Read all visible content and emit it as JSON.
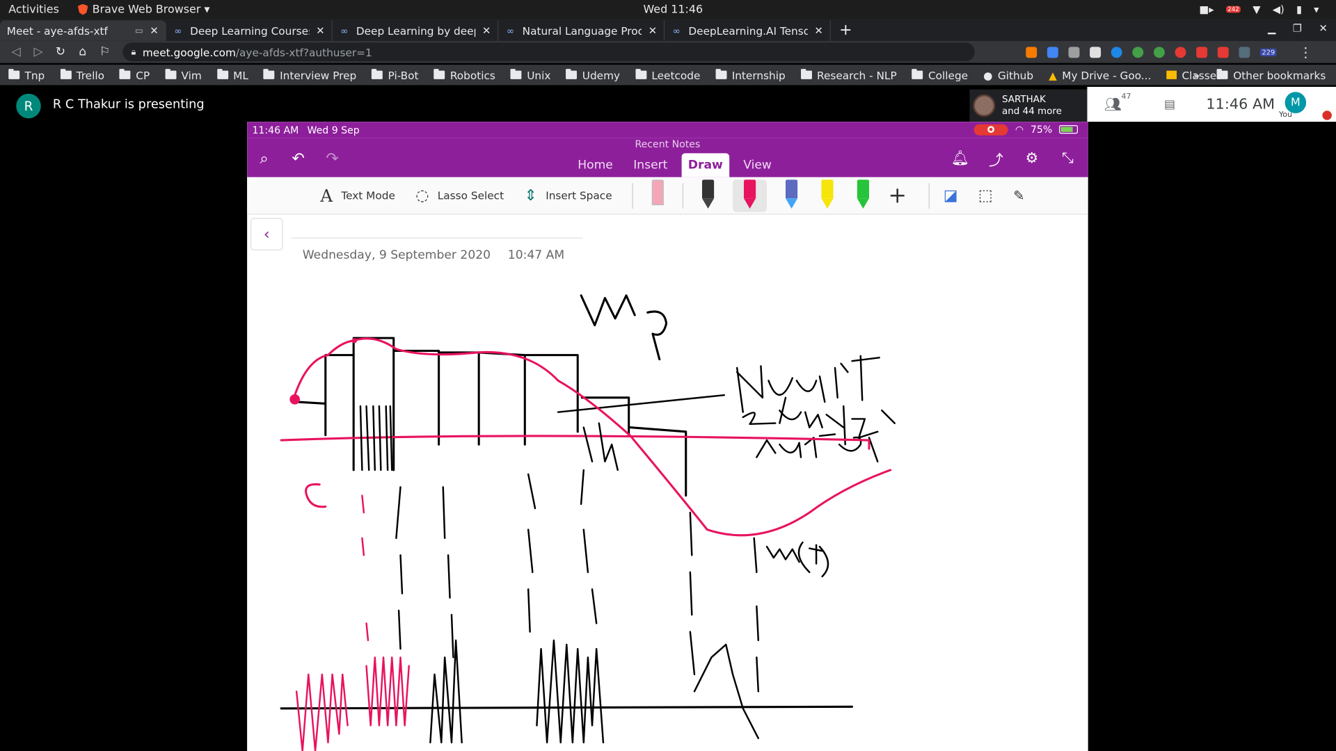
{
  "gnome": {
    "activities": "Activities",
    "app_name": "Brave Web Browser ▾",
    "clock": "Wed 11:46",
    "notification_count": "242"
  },
  "tabs": [
    {
      "title": "Meet - aye-afds-xtf",
      "active": true
    },
    {
      "title": "Deep Learning Courses | Co"
    },
    {
      "title": "Deep Learning by deeplear"
    },
    {
      "title": "Natural Language Processi"
    },
    {
      "title": "DeepLearning.AI TensorFlo"
    }
  ],
  "address": {
    "domain": "meet.google.com",
    "path": "/aye-afds-xtf?authuser=1"
  },
  "extensions": {
    "badge": "229"
  },
  "bookmarks": [
    "Tnp",
    "Trello",
    "CP",
    "Vim",
    "ML",
    "Interview Prep",
    "Pi-Bot",
    "Robotics",
    "Unix",
    "Udemy",
    "Leetcode",
    "Internship",
    "Research - NLP",
    "College"
  ],
  "bookmark_github": "Github",
  "bookmark_drive": "My Drive - Goo...",
  "bookmark_classes": "Classes",
  "bookmark_more": "»",
  "bookmark_other": "Other bookmarks",
  "meet": {
    "presenter_initial": "R",
    "presenting_text": "R C Thakur is presenting",
    "participant_name": "SARTHAK",
    "participant_more": "and 44 more",
    "people_count": "47",
    "time": "11:46  AM",
    "self_initial": "M",
    "self_label": "You"
  },
  "ipad": {
    "time": "11:46 AM",
    "date": "Wed 9 Sep",
    "battery": "75%"
  },
  "onenote": {
    "recent": "Recent Notes",
    "tabs": [
      "Home",
      "Insert",
      "Draw",
      "View"
    ],
    "active_tab": "Draw",
    "text_mode": "Text Mode",
    "lasso": "Lasso Select",
    "insert_space": "Insert Space",
    "page_date": "Wednesday, 9 September 2020",
    "page_time": "10:47 AM"
  },
  "colors": {
    "onenote_purple": "#8e1f9b",
    "ink_pink": "#e8135f",
    "ink_black": "#000000"
  }
}
